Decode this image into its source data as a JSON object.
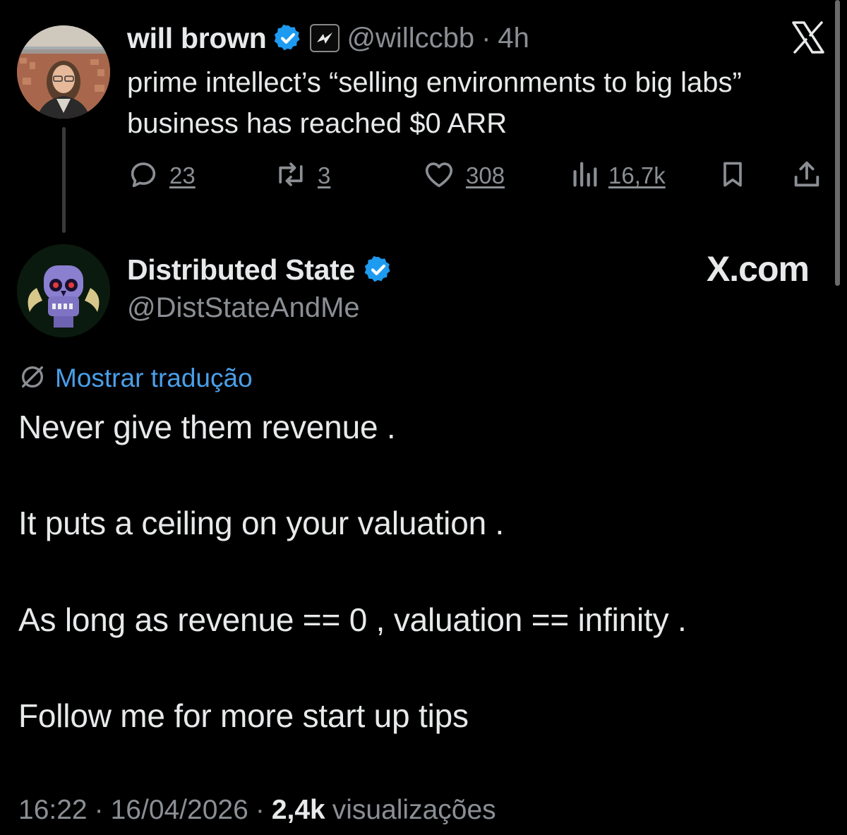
{
  "quoted_tweet": {
    "author_name": "will brown",
    "handle": "@willccbb",
    "separator": "·",
    "time": "4h",
    "text": "prime intellect’s “selling environments to big labs” business has reached $0 ARR",
    "stats": {
      "replies": "23",
      "reposts": "3",
      "likes": "308",
      "views": "16,7k"
    }
  },
  "tweet": {
    "author_name": "Distributed State",
    "handle": "@DistStateAndMe",
    "brand": "X.com",
    "translate_label": "Mostrar tradução",
    "lines": [
      "Never give them revenue .",
      "It puts a ceiling on your valuation .",
      "As long as revenue == 0 , valuation == infinity .",
      "Follow me for more start up tips"
    ],
    "footer": {
      "time": "16:22",
      "sep1": "·",
      "date": "16/04/2026",
      "sep2": "·",
      "views_count": "2,4k",
      "views_label": "visualizações"
    }
  },
  "icons": {
    "verified_badge": "verified-badge-icon",
    "affiliate_badge": "affiliate-badge-icon",
    "close": "x-logo-icon",
    "reply": "reply-icon",
    "repost": "repost-icon",
    "like": "heart-icon",
    "views": "views-icon",
    "bookmark": "bookmark-icon",
    "share": "share-icon",
    "translate": "translate-icon"
  },
  "colors": {
    "background": "#000000",
    "text": "#e7e9ea",
    "muted": "#8b8f94",
    "link": "#4a9fe8",
    "verified": "#1d9bf0"
  }
}
